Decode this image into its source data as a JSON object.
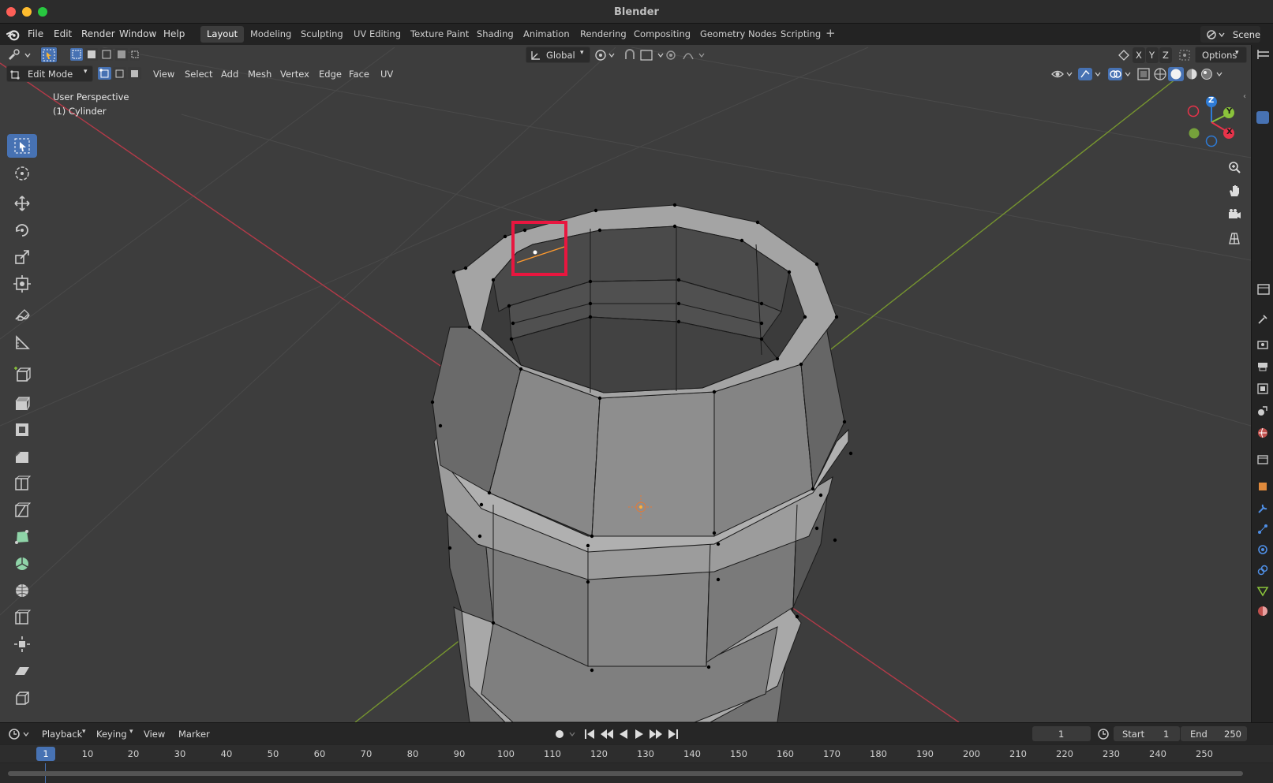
{
  "window": {
    "title": "Blender"
  },
  "menu": {
    "file": "File",
    "edit": "Edit",
    "render": "Render",
    "window": "Window",
    "help": "Help"
  },
  "workspaces": [
    "Layout",
    "Modeling",
    "Sculpting",
    "UV Editing",
    "Texture Paint",
    "Shading",
    "Animation",
    "Rendering",
    "Compositing",
    "Geometry Nodes",
    "Scripting"
  ],
  "active_workspace": "Layout",
  "scene": {
    "label": "Scene"
  },
  "tool_header": {
    "orientation": "Global",
    "axes": [
      "X",
      "Y",
      "Z"
    ],
    "options": "Options"
  },
  "viewport_header": {
    "mode": "Edit Mode",
    "menus": [
      "View",
      "Select",
      "Add",
      "Mesh",
      "Vertex",
      "Edge",
      "Face",
      "UV"
    ]
  },
  "overlay": {
    "perspective": "User Perspective",
    "object": "(1) Cylinder"
  },
  "gizmo": {
    "x": "X",
    "y": "Y",
    "z": "Z"
  },
  "colors": {
    "accent": "#4772b3",
    "x_axis": "#e8334a",
    "y_axis": "#8ac33b",
    "z_axis": "#2e7bd6",
    "highlight_box": "#e8163f"
  },
  "tools": [
    "select-box",
    "cursor",
    "move",
    "rotate",
    "scale",
    "transform",
    "annotate",
    "measure",
    "add-cube",
    "extrude",
    "inset",
    "bevel",
    "loop-cut",
    "knife",
    "poly-build",
    "spin",
    "smooth",
    "edge-slide",
    "shrink-fatten",
    "shear",
    "rip"
  ],
  "timeline": {
    "menus": [
      "Playback",
      "Keying",
      "View",
      "Marker"
    ],
    "current_frame": "1",
    "start_label": "Start",
    "start": "1",
    "end_label": "End",
    "end": "250",
    "ruler": [
      "1",
      "10",
      "20",
      "30",
      "40",
      "50",
      "60",
      "70",
      "80",
      "90",
      "100",
      "110",
      "120",
      "130",
      "140",
      "150",
      "160",
      "170",
      "180",
      "190",
      "200",
      "210",
      "220",
      "230",
      "240",
      "250"
    ]
  }
}
